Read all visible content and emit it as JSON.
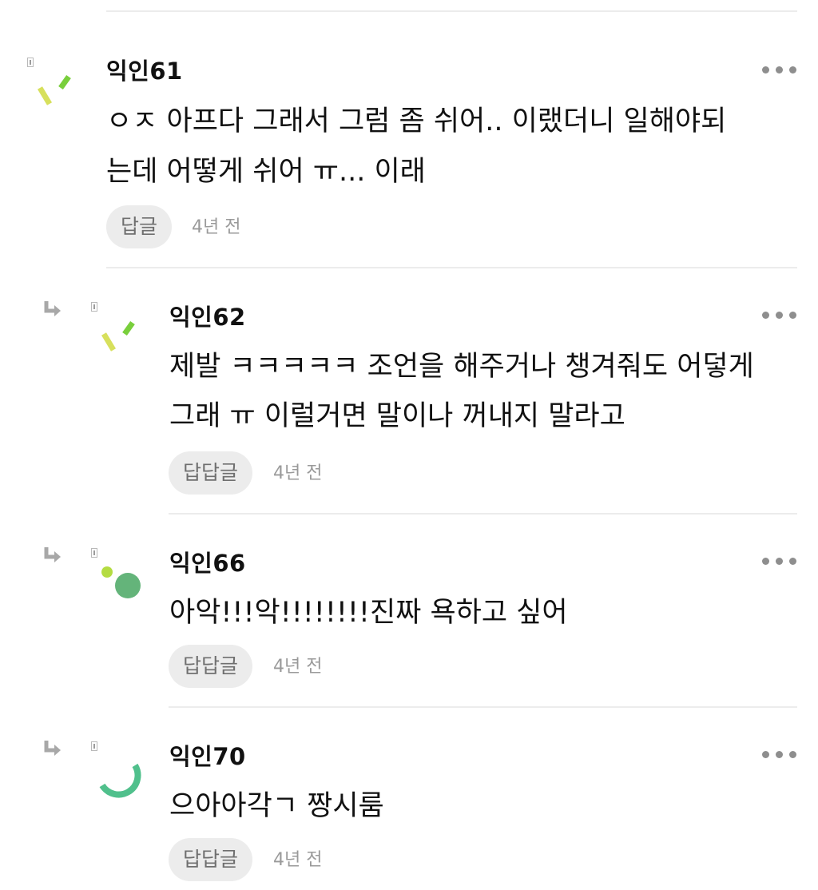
{
  "comments": [
    {
      "author": "익인61",
      "lines": [
        "ㅇㅈ 아프다 그래서 그럼 좀 쉬어.. 이랬더니 일해야되",
        "는데 어떻게 쉬어 ㅠ... 이래"
      ],
      "reply_label": "답글",
      "time": "4년 전",
      "avatar_icon": "confetti-avatar-icon",
      "is_reply": false
    },
    {
      "author": "익인62",
      "lines": [
        "제발 ㅋㅋㅋㅋㅋ 조언을 해주거나 챙겨줘도 어덯게",
        "그래 ㅠ 이럴거면 말이나 꺼내지 말라고"
      ],
      "reply_label": "답답글",
      "time": "4년 전",
      "avatar_icon": "confetti-avatar-icon",
      "is_reply": true
    },
    {
      "author": "익인66",
      "lines": [
        "아악!!!악!!!!!!!!진짜 욕하고 싶어"
      ],
      "reply_label": "답답글",
      "time": "4년 전",
      "avatar_icon": "dots-avatar-icon",
      "is_reply": true
    },
    {
      "author": "익인70",
      "lines": [
        "으아아각ㄱ 짱시룸"
      ],
      "reply_label": "답답글",
      "time": "4년 전",
      "avatar_icon": "arc-avatar-icon",
      "is_reply": true
    }
  ],
  "colors": {
    "avatar_yellow_green": "#d7e05c",
    "avatar_green": "#79cf3c",
    "avatar_dark_green": "#64b47a",
    "avatar_teal": "#50c08c",
    "muted_gray": "#8e8e8e",
    "pill_bg": "#ececec"
  }
}
